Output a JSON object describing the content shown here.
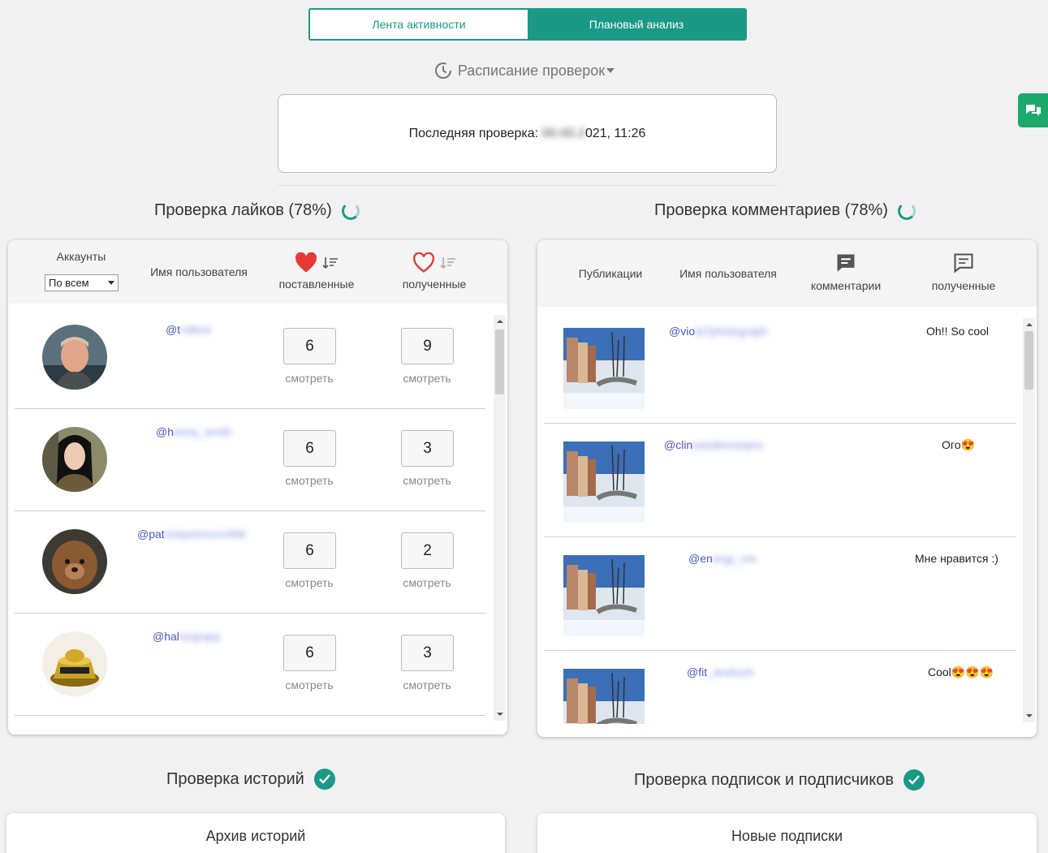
{
  "tabs": [
    {
      "label": "Лента активности",
      "active": false
    },
    {
      "label": "Плановый анализ",
      "active": true
    }
  ],
  "schedule": {
    "label": "Расписание проверок",
    "icon": "clock-history-icon"
  },
  "last_check": {
    "label": "Последняя проверка:",
    "date_hidden": "00.00.2",
    "date_visible": "021, 11:26"
  },
  "likes": {
    "title": "Проверка лайков (78%)",
    "headers": {
      "accounts": "Аккаунты",
      "username": "Имя пользователя",
      "given": "поставленные",
      "received": "полученные"
    },
    "filter": "По всем",
    "view_label": "смотреть",
    "rows": [
      {
        "handle": "@t",
        "handle_hidden": "rolloni",
        "given": "6",
        "received": "9"
      },
      {
        "handle": "@h",
        "handle_hidden": "enny_smith",
        "given": "6",
        "received": "3"
      },
      {
        "handle": "@pat",
        "handle_hidden": "rickpetrson1999",
        "given": "6",
        "received": "2"
      },
      {
        "handle": "@hal",
        "handle_hidden": "lorgrapy",
        "given": "6",
        "received": "3"
      }
    ]
  },
  "comments": {
    "title": "Проверка комментариев (78%)",
    "headers": {
      "posts": "Публикации",
      "username": "Имя пользователя",
      "comments": "комментарии",
      "received": "полученные"
    },
    "rows": [
      {
        "handle": "@vio",
        "handle_hidden": "la7photograph",
        "text": "Oh!! So cool"
      },
      {
        "handle": "@clin",
        "handle_hidden": "eandersonpro",
        "text": "Ого😍"
      },
      {
        "handle": "@en",
        "handle_hidden": "ergy_om",
        "text": "Мне нравится :)"
      },
      {
        "handle": "@fit",
        "handle_hidden": "_andsom",
        "text": "Cool😍😍😍"
      }
    ]
  },
  "stories": {
    "title": "Проверка историй",
    "card": "Архив историй"
  },
  "follows": {
    "title": "Проверка подписок и подписчиков",
    "card": "Новые подписки"
  },
  "colors": {
    "accent": "#1a9a86",
    "heart": "#e53935",
    "link": "#4a57c8",
    "chat": "#1aaa6a"
  }
}
